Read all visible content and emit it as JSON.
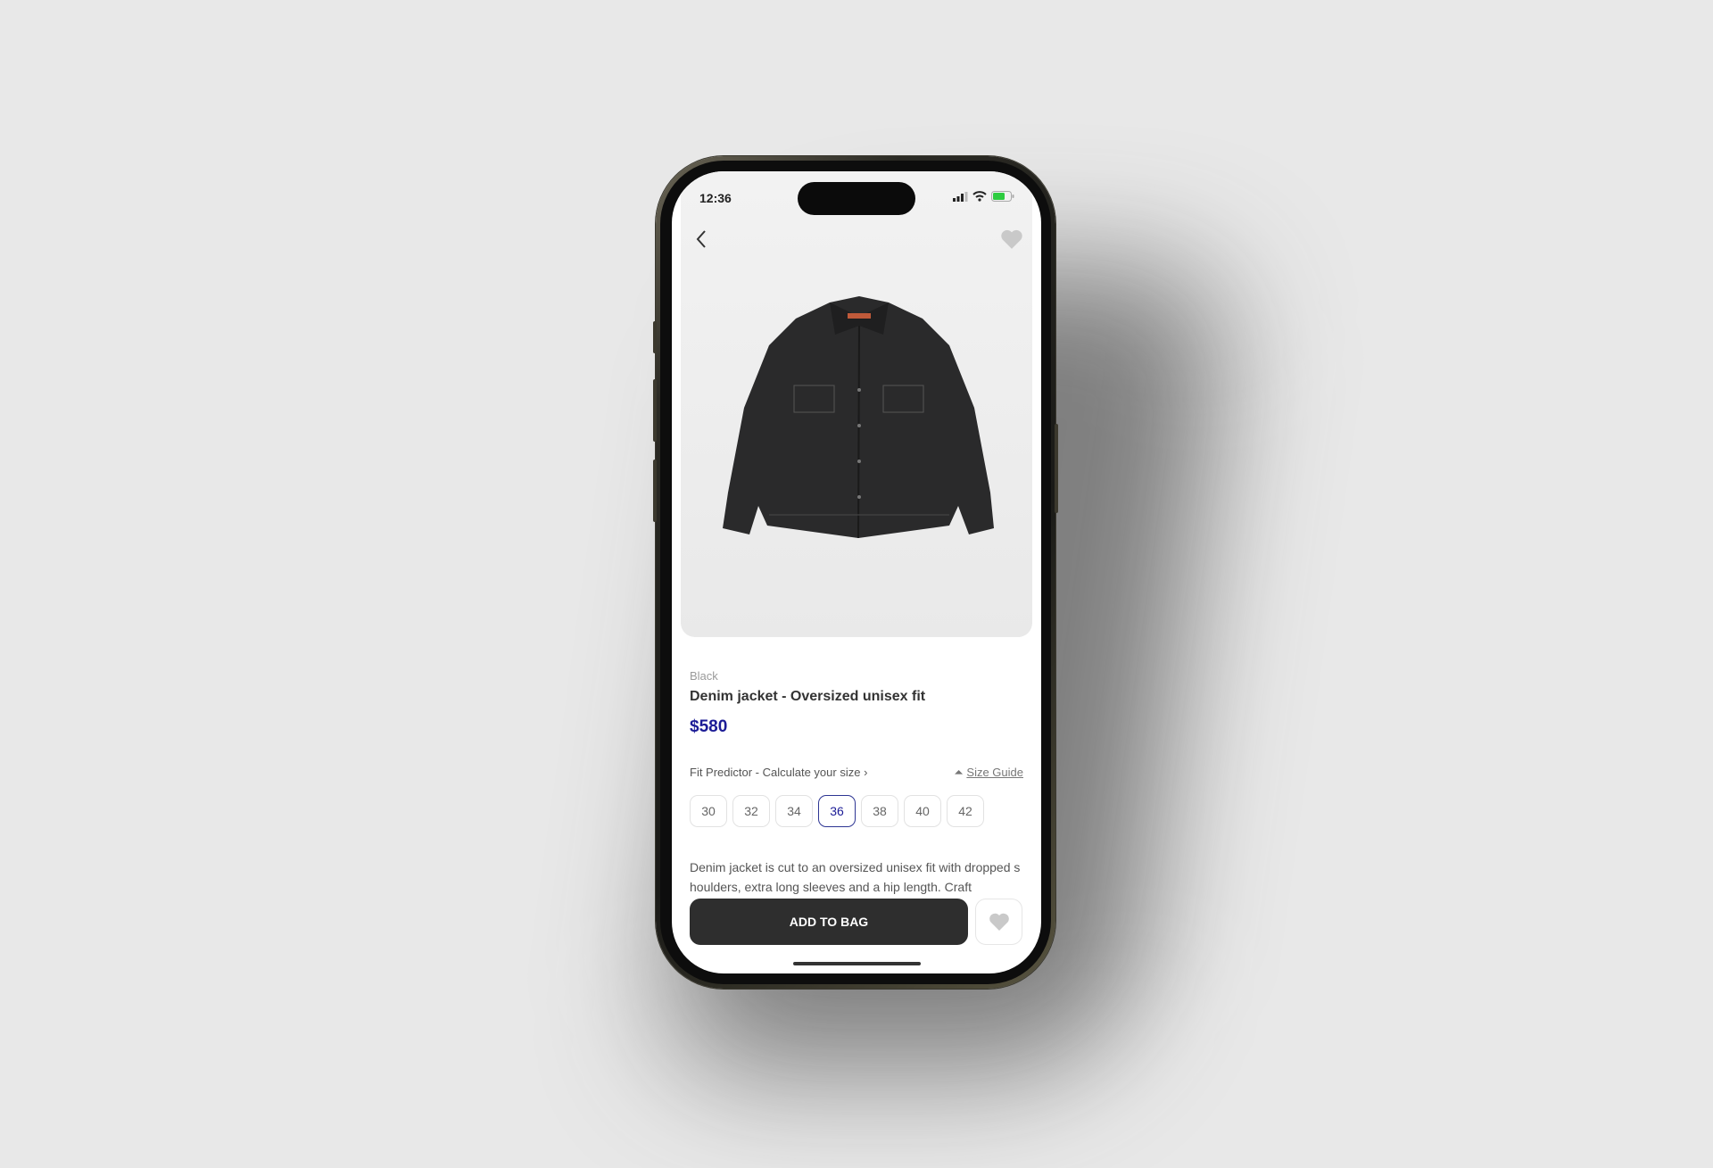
{
  "status_bar": {
    "time": "12:36",
    "battery_color": "#2ecc40"
  },
  "nav": {
    "back_icon": "chevron-left-icon",
    "favorite_icon": "heart-icon"
  },
  "product": {
    "color": "Black",
    "title": "Denim jacket - Oversized unisex fit",
    "price": "$580",
    "price_color": "#1c1c96"
  },
  "fit": {
    "predictor_label": "Fit Predictor - Calculate your size",
    "size_guide_label": "Size Guide"
  },
  "sizes": {
    "options": [
      "30",
      "32",
      "34",
      "36",
      "38",
      "40",
      "42"
    ],
    "selected": "36"
  },
  "description": "Denim jacket is cut to an oversized unisex fit with dropped shoulders, extra long sleeves and a hip length. Craft",
  "actions": {
    "add_to_bag": "ADD TO BAG"
  }
}
